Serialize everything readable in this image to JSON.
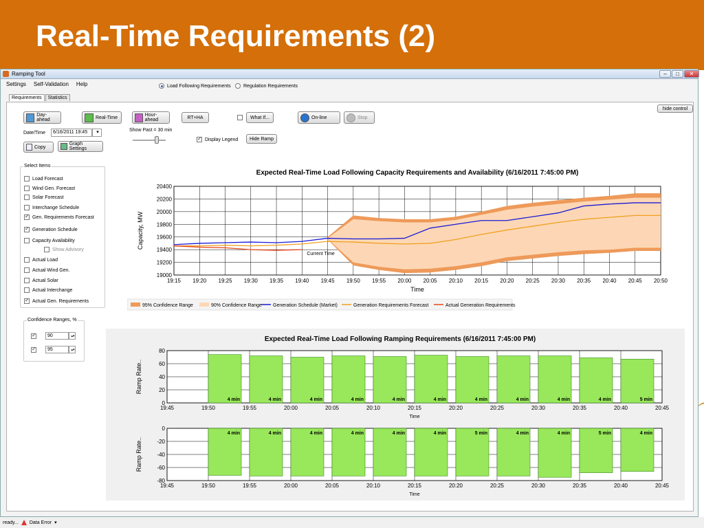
{
  "slide": {
    "title": "Real-Time Requirements (2)"
  },
  "window": {
    "title": "Ramping Tool"
  },
  "menu": [
    "Settings",
    "Self-Validation",
    "Help"
  ],
  "tabs": [
    "Requirements",
    "Statistics"
  ],
  "mode": {
    "option1": "Load Following Requirements",
    "option2": "Regulation Requirements",
    "selected": "Load Following Requirements"
  },
  "toolbar": {
    "day_ahead": "Day-ahead",
    "real_time": "Real-Time",
    "hour_ahead": "Hour-ahead",
    "rt_ha": "RT+HA",
    "what_if": "What If...",
    "online": "On-line",
    "stop": "Stop",
    "hide_control": "hide control",
    "copy": "Copy",
    "graph_settings": "Graph Settings",
    "hide_ramp": "Hide Ramp",
    "display_legend": "Display Legend",
    "date_label": "Date/Time",
    "date_value": "6/16/2011 19:45",
    "show_past": "Show Past = 30 min"
  },
  "select_items": {
    "title": "Select Items",
    "items": [
      {
        "label": "Load Forecast",
        "checked": false
      },
      {
        "label": "Wind Gen. Forecast",
        "checked": false
      },
      {
        "label": "Solar Forecast",
        "checked": false
      },
      {
        "label": "Interchange Schedule",
        "checked": false
      },
      {
        "label": "Gen. Requirements Forecast",
        "checked": true
      },
      {
        "label": "Generation Schedule",
        "checked": true
      },
      {
        "label": "Capacity Availability",
        "checked": false
      },
      {
        "label": "Show Advisory",
        "checked": false
      },
      {
        "label": "Actual Load",
        "checked": false
      },
      {
        "label": "Actual Wind Gen.",
        "checked": false
      },
      {
        "label": "Actual Solar",
        "checked": false
      },
      {
        "label": "Actual Interchange",
        "checked": false
      },
      {
        "label": "Actual Gen. Requirements",
        "checked": true
      }
    ]
  },
  "confidence": {
    "title": "Confidence Ranges, %",
    "values": [
      "90",
      "95"
    ]
  },
  "status": {
    "ready": "ready...",
    "error": "Data Error"
  },
  "chart_data": [
    {
      "type": "line",
      "title": "Expected Real-Time Load Following Capacity Requirements and Availability (6/16/2011 7:45:00 PM)",
      "xlabel": "Time",
      "ylabel": "Capacity, MW",
      "x": [
        "19:15",
        "19:20",
        "19:25",
        "19:30",
        "19:35",
        "19:40",
        "19:45",
        "19:50",
        "19:55",
        "20:00",
        "20:05",
        "20:10",
        "20:15",
        "20:20",
        "20:25",
        "20:30",
        "20:35",
        "20:40",
        "20:45",
        "20:50"
      ],
      "ylim": [
        19000,
        20400
      ],
      "yticks": [
        19000,
        19200,
        19400,
        19600,
        19800,
        20000,
        20200,
        20400
      ],
      "annotation": "Current Time",
      "series": [
        {
          "name": "95% Confidence Range",
          "color": "#ee9a5a",
          "upper": [
            null,
            null,
            null,
            null,
            null,
            null,
            19600,
            19940,
            19900,
            19880,
            19880,
            19920,
            20000,
            20090,
            20140,
            20180,
            20220,
            20250,
            20290,
            20290
          ],
          "lower": [
            null,
            null,
            null,
            null,
            null,
            null,
            19560,
            19150,
            19080,
            19030,
            19040,
            19080,
            19140,
            19220,
            19260,
            19300,
            19330,
            19350,
            19380,
            19380
          ]
        },
        {
          "name": "90% Confidence Range",
          "color": "#fdd7b5",
          "upper": [
            null,
            null,
            null,
            null,
            null,
            null,
            19580,
            19880,
            19850,
            19830,
            19830,
            19870,
            19950,
            20030,
            20080,
            20120,
            20160,
            20190,
            20220,
            20220
          ],
          "lower": [
            null,
            null,
            null,
            null,
            null,
            null,
            19570,
            19200,
            19130,
            19090,
            19100,
            19140,
            19200,
            19280,
            19320,
            19360,
            19390,
            19400,
            19430,
            19430
          ]
        },
        {
          "name": "Generation Schedule (Market)",
          "color": "#1a1ad6",
          "values": [
            19480,
            19500,
            19510,
            19520,
            19510,
            19530,
            19580,
            19570,
            19570,
            19580,
            19740,
            19800,
            19860,
            19860,
            19920,
            19980,
            20090,
            20120,
            20140,
            20140
          ]
        },
        {
          "name": "Generation Requirements Forecast",
          "color": "#f0a020",
          "values": [
            19460,
            19460,
            19470,
            19460,
            19470,
            19490,
            19530,
            19520,
            19500,
            19490,
            19500,
            19560,
            19640,
            19710,
            19770,
            19830,
            19880,
            19910,
            19940,
            19940
          ]
        },
        {
          "name": "Actual Generation Requirements",
          "color": "#e8461a",
          "values": [
            19460,
            19440,
            19430,
            19400,
            19390,
            19400,
            null,
            null,
            null,
            null,
            null,
            null,
            null,
            null,
            null,
            null,
            null,
            null,
            null,
            null
          ]
        }
      ]
    },
    {
      "type": "bar",
      "title": "Expected Real-Time Load Following Ramping Requirements (6/16/2011 7:45:00 PM)",
      "xlabel": "Time",
      "ylabel": "Ramp Rate..",
      "categories": [
        "19:50",
        "19:55",
        "20:00",
        "20:05",
        "20:10",
        "20:15",
        "20:20",
        "20:25",
        "20:30",
        "20:35",
        "20:40"
      ],
      "xticks": [
        "19:45",
        "19:50",
        "19:55",
        "20:00",
        "20:05",
        "20:10",
        "20:15",
        "20:20",
        "20:25",
        "20:30",
        "20:35",
        "20:40",
        "20:45"
      ],
      "ylim": [
        0,
        80
      ],
      "yticks": [
        0,
        20,
        40,
        60,
        80
      ],
      "values": [
        74,
        72,
        70,
        72,
        71,
        73,
        71,
        72,
        72,
        69,
        67
      ],
      "labels": [
        "4 min",
        "4 min",
        "4 min",
        "4 min",
        "4 min",
        "4 min",
        "4 min",
        "4 min",
        "4 min",
        "4 min",
        "5 min"
      ],
      "color": "#99e75a"
    },
    {
      "type": "bar",
      "title": "",
      "xlabel": "Time",
      "ylabel": "Ramp Rate..",
      "categories": [
        "19:50",
        "19:55",
        "20:00",
        "20:05",
        "20:10",
        "20:15",
        "20:20",
        "20:25",
        "20:30",
        "20:35",
        "20:40"
      ],
      "xticks": [
        "19:45",
        "19:50",
        "19:55",
        "20:00",
        "20:05",
        "20:10",
        "20:15",
        "20:20",
        "20:25",
        "20:30",
        "20:35",
        "20:40",
        "20:45"
      ],
      "ylim": [
        -80,
        0
      ],
      "yticks": [
        0,
        -20,
        -40,
        -60,
        -80
      ],
      "values": [
        -72,
        -73,
        -73,
        -73,
        -73,
        -73,
        -73,
        -73,
        -75,
        -68,
        -66
      ],
      "labels": [
        "4 min",
        "4 min",
        "4 min",
        "4 min",
        "4 min",
        "4 min",
        "5 min",
        "4 min",
        "4 min",
        "5 min",
        "4 min"
      ],
      "color": "#99e75a"
    }
  ]
}
